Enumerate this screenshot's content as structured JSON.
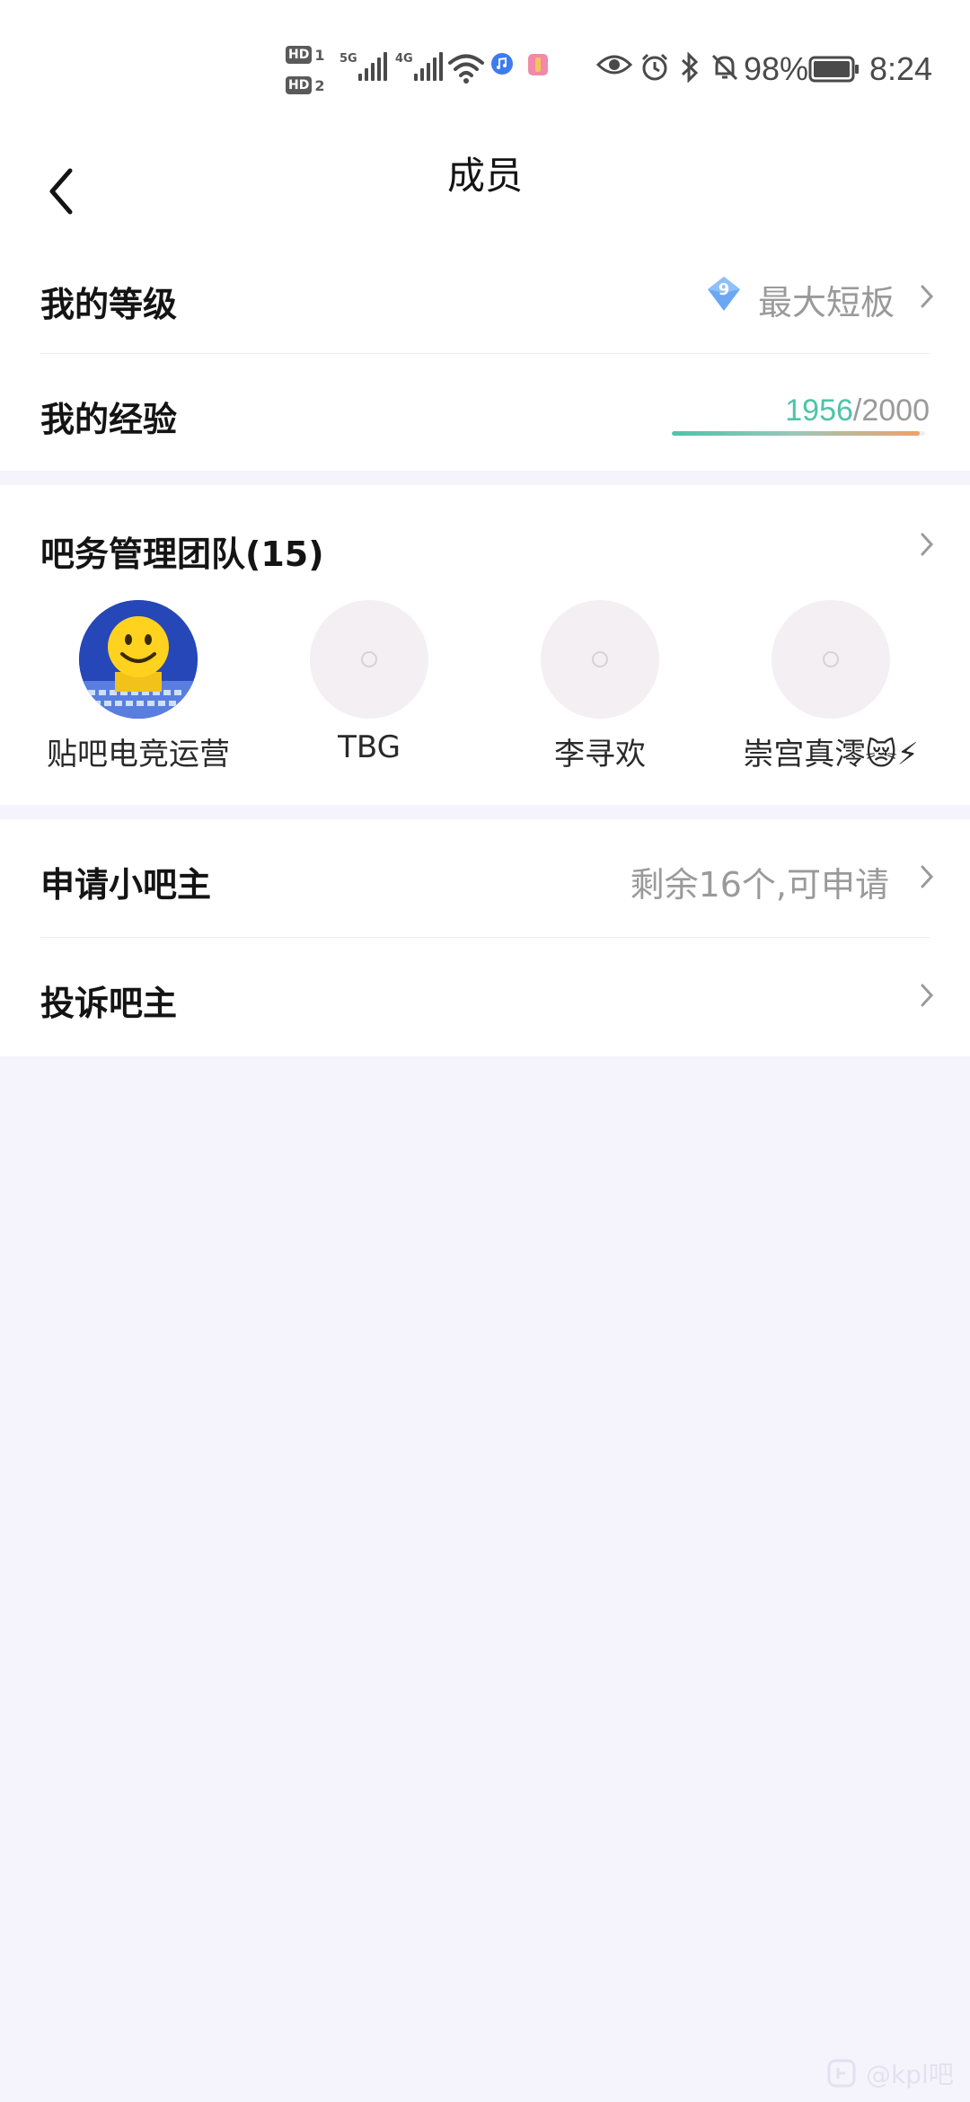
{
  "status_bar": {
    "hd1": "HD",
    "hd1_num": "1",
    "hd2": "HD",
    "hd2_num": "2",
    "sig1_gen": "5G",
    "sig2_gen": "4G",
    "battery_text": "98%",
    "time": "8:24",
    "icons": [
      "wifi-icon",
      "music-icon",
      "app-icon",
      "eye-icon",
      "alarm-icon",
      "bluetooth-icon",
      "mute-icon",
      "battery-icon"
    ]
  },
  "header": {
    "title": "成员"
  },
  "level": {
    "label": "我的等级",
    "badge_number": "9",
    "value": "最大短板"
  },
  "experience": {
    "label": "我的经验",
    "current": "1956",
    "separator": "/",
    "max": "2000",
    "progress": 0.978
  },
  "team": {
    "title": "吧务管理团队(15)",
    "members": [
      {
        "name": "贴吧电竞运营"
      },
      {
        "name": "TBG"
      },
      {
        "name": "李寻欢"
      },
      {
        "name": "崇宫真澪😿⚡"
      }
    ]
  },
  "apply": {
    "label": "申请小吧主",
    "value": "剩余16个,可申请"
  },
  "complain": {
    "label": "投诉吧主"
  },
  "watermark": {
    "text": "@kpl吧"
  },
  "colors": {
    "accent_teal": "#4fc3a8",
    "accent_orange": "#f0a06a",
    "page_bg": "#f5f4fd",
    "badge_blue": "#5b9cf0"
  }
}
